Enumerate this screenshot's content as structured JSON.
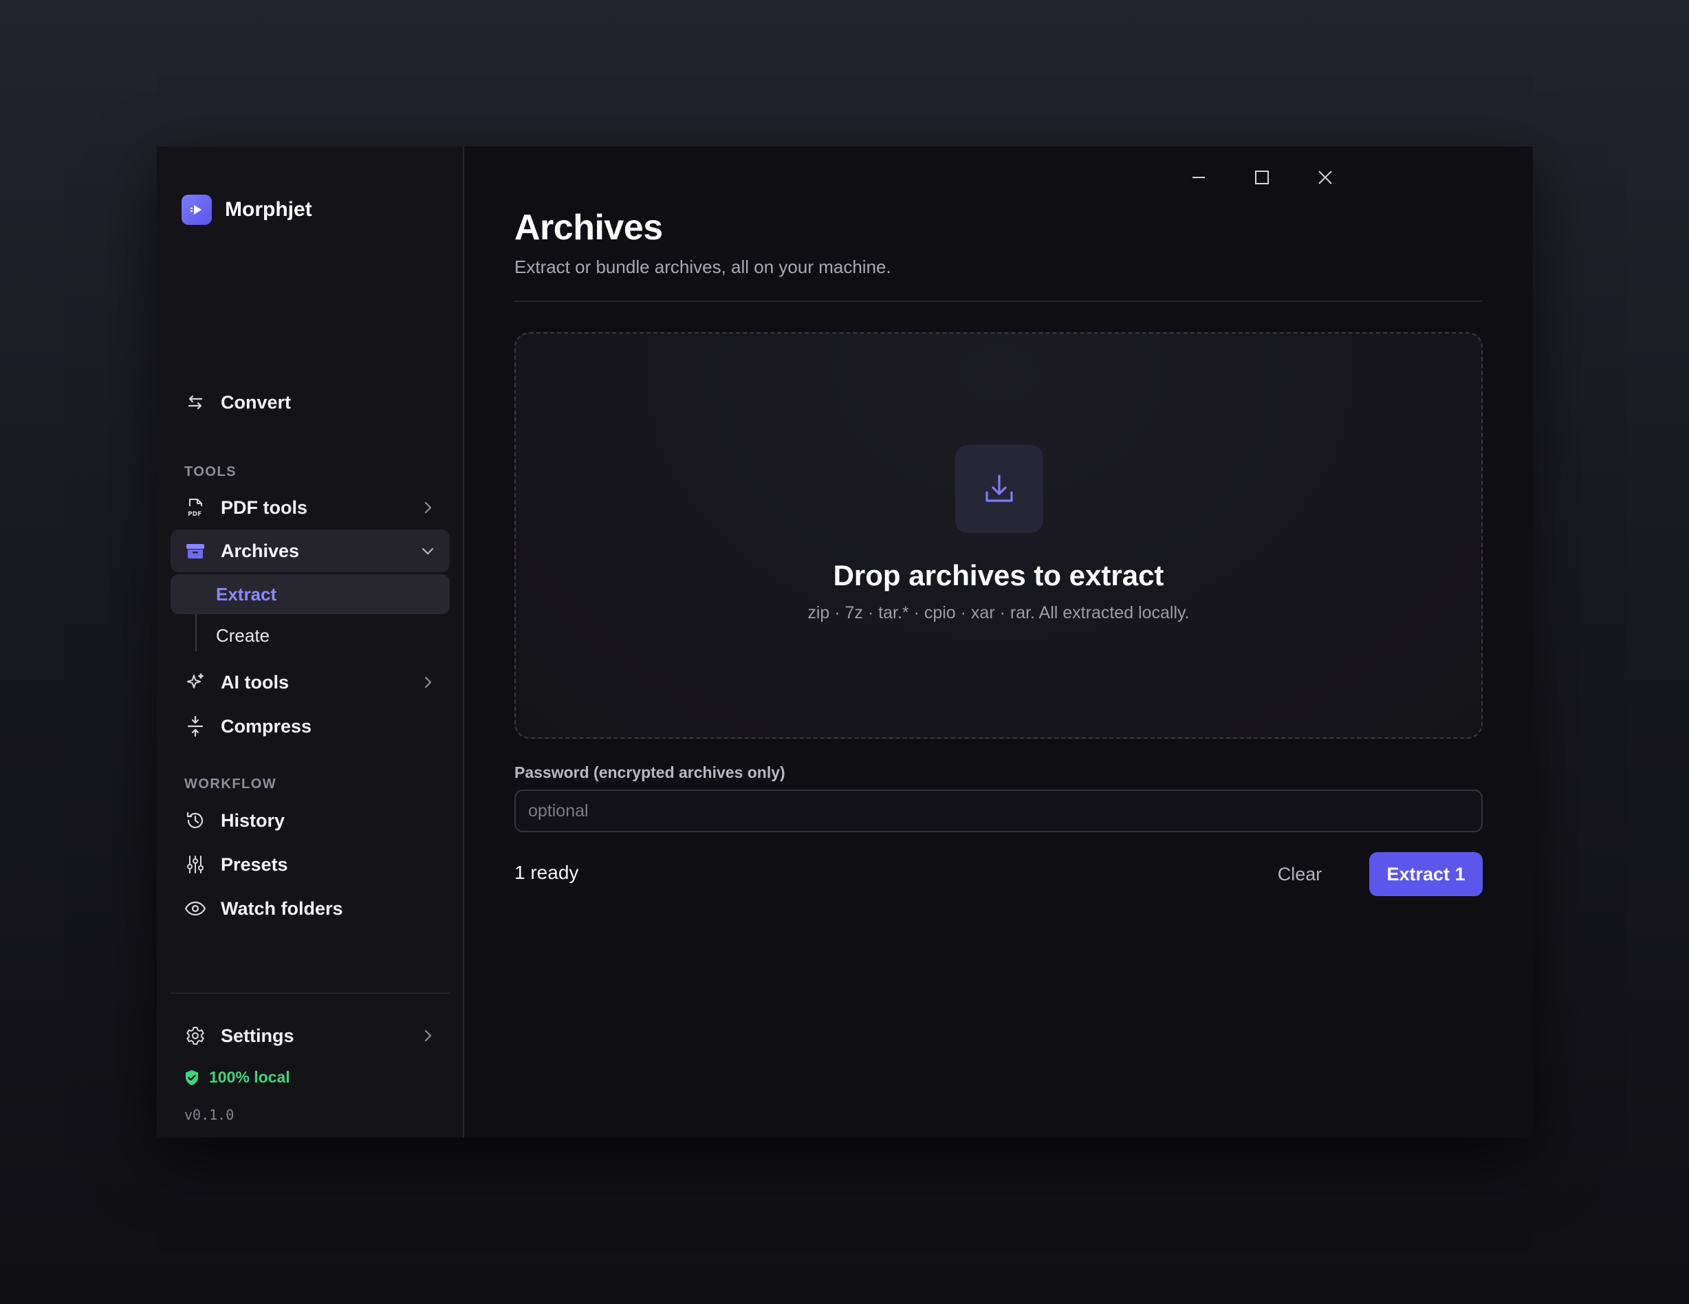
{
  "app": {
    "name": "Morphjet",
    "version": "v0.1.0"
  },
  "sidebar": {
    "convert_label": "Convert",
    "tools_section": "TOOLS",
    "pdf_tools_label": "PDF tools",
    "archives_label": "Archives",
    "archives_sub": {
      "extract_label": "Extract",
      "create_label": "Create"
    },
    "ai_tools_label": "AI tools",
    "compress_label": "Compress",
    "workflow_section": "WORKFLOW",
    "history_label": "History",
    "presets_label": "Presets",
    "watch_folders_label": "Watch folders",
    "settings_label": "Settings",
    "local_badge": "100% local",
    "active_item": "Archives / Extract"
  },
  "main": {
    "title": "Archives",
    "subtitle": "Extract or bundle archives, all on your machine.",
    "dropzone": {
      "title": "Drop archives to extract",
      "hint": "zip · 7z · tar.* · cpio · xar · rar. All extracted locally."
    },
    "password": {
      "label": "Password (encrypted archives only)",
      "placeholder": "optional",
      "value": ""
    },
    "status_text": "1 ready",
    "clear_label": "Clear",
    "extract_label": "Extract 1"
  },
  "colors": {
    "accent": "#5b57ec",
    "accent_text": "#8b87ff",
    "success": "#3ed67c"
  },
  "icons": {
    "brand": "play-logo-icon",
    "convert": "arrows-swap-icon",
    "pdf": "pdf-file-icon",
    "archives": "archive-box-icon",
    "ai": "sparkle-icon",
    "compress": "compress-icon",
    "history": "history-icon",
    "presets": "sliders-icon",
    "watch": "eye-icon",
    "settings": "gear-icon",
    "local": "shield-check-icon",
    "drop": "download-tray-icon"
  }
}
